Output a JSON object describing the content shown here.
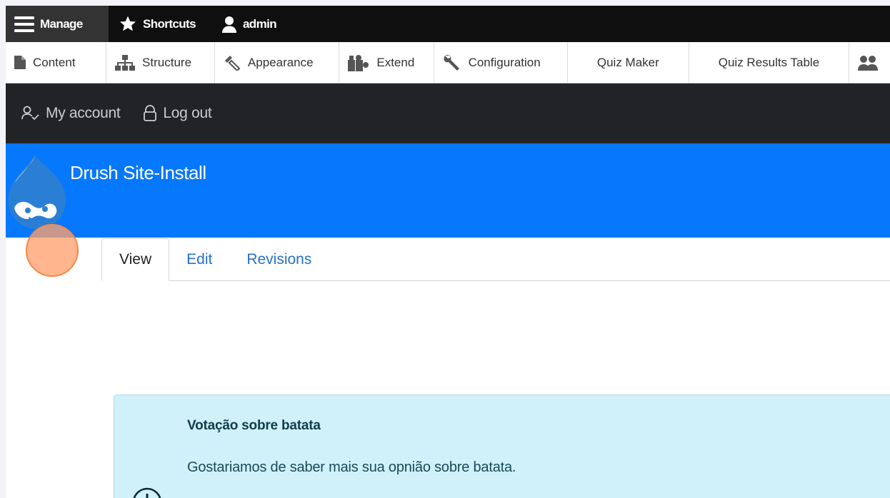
{
  "toolbar": {
    "manage_label": "Manage",
    "shortcuts_label": "Shortcuts",
    "user_label": "admin"
  },
  "admin_menu": {
    "items": [
      {
        "label": "Content",
        "icon": "file-icon"
      },
      {
        "label": "Structure",
        "icon": "sitemap-icon"
      },
      {
        "label": "Appearance",
        "icon": "paintbrush-icon"
      },
      {
        "label": "Extend",
        "icon": "puzzle-icon"
      },
      {
        "label": "Configuration",
        "icon": "wrench-icon"
      },
      {
        "label": "Quiz Maker"
      },
      {
        "label": "Quiz Results Table"
      }
    ]
  },
  "secondary_menu": {
    "my_account": "My account",
    "log_out": "Log out"
  },
  "site": {
    "name": "Drush Site-Install",
    "brand_color": "#0678fe"
  },
  "tabs": [
    {
      "label": "View",
      "active": true
    },
    {
      "label": "Edit",
      "active": false
    },
    {
      "label": "Revisions",
      "active": false
    }
  ],
  "message": {
    "title": "Votação sobre batata",
    "text": "Gostariamos de saber mais sua opnião sobre batata."
  }
}
